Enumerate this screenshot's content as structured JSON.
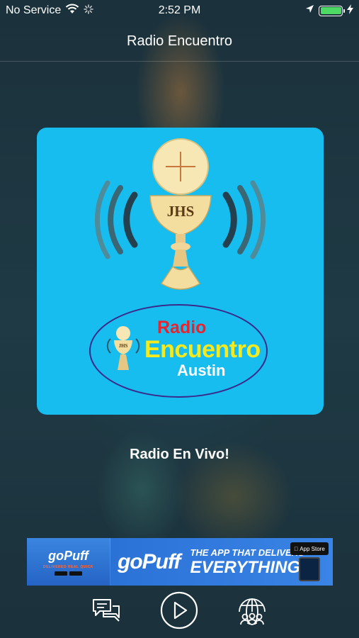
{
  "status_bar": {
    "carrier": "No Service",
    "time": "2:52 PM",
    "icons": [
      "wifi-icon",
      "activity-spinner-icon",
      "location-arrow-icon",
      "battery-icon",
      "charging-bolt-icon"
    ],
    "battery_level": 1.0,
    "battery_color": "#4cd964"
  },
  "nav": {
    "title": "Radio Encuentro"
  },
  "artwork": {
    "background_color": "#18bdf0",
    "monogram": "JHS",
    "logo_line1": "Radio",
    "logo_line2": "Encuentro",
    "logo_line3": "Austin",
    "logo_colors": {
      "radio": "#e8242e",
      "encuentro": "#f5ea1d",
      "austin": "#ffffff",
      "ellipse": "#3a2a8c"
    }
  },
  "now_playing": {
    "label": "Radio En Vivo!"
  },
  "ad_banner": {
    "left_logo": "goPuff",
    "left_tagline": "DELIVERED REAL QUICK",
    "brand": "goPuff",
    "headline_line1": "THE APP THAT DELIVERS",
    "headline_line2": "EVERYTHING!",
    "store_badge": "App Store"
  },
  "toolbar": {
    "buttons": [
      "chat-icon",
      "play-icon",
      "globe-people-icon"
    ]
  }
}
